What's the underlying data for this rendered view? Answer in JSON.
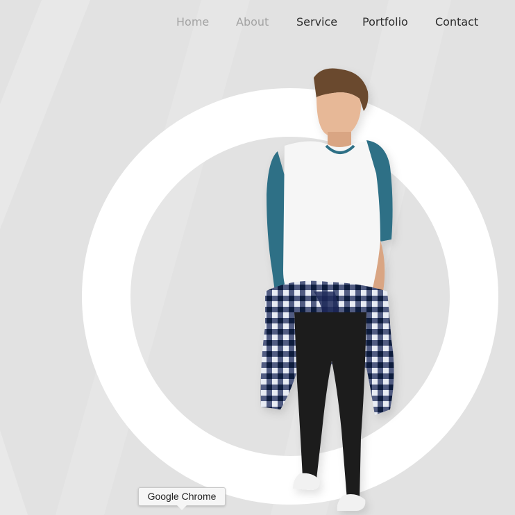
{
  "nav": {
    "items": [
      {
        "label": "Home",
        "state": "muted"
      },
      {
        "label": "About",
        "state": "muted"
      },
      {
        "label": "Service",
        "state": "active"
      },
      {
        "label": "Portfolio",
        "state": "active"
      },
      {
        "label": "Contact",
        "state": "active"
      }
    ]
  },
  "hero": {
    "decoration": "white-ring",
    "image": "male-model-raglan-tee-flannel-at-waist"
  },
  "tooltip": {
    "text": "Google Chrome"
  },
  "colors": {
    "background": "#e2e2e2",
    "nav_muted": "#a3a3a3",
    "nav_active": "#2e2e2e",
    "ring": "#ffffff",
    "sleeve": "#2f6f86",
    "flannel_navy": "#1e2a5c"
  }
}
